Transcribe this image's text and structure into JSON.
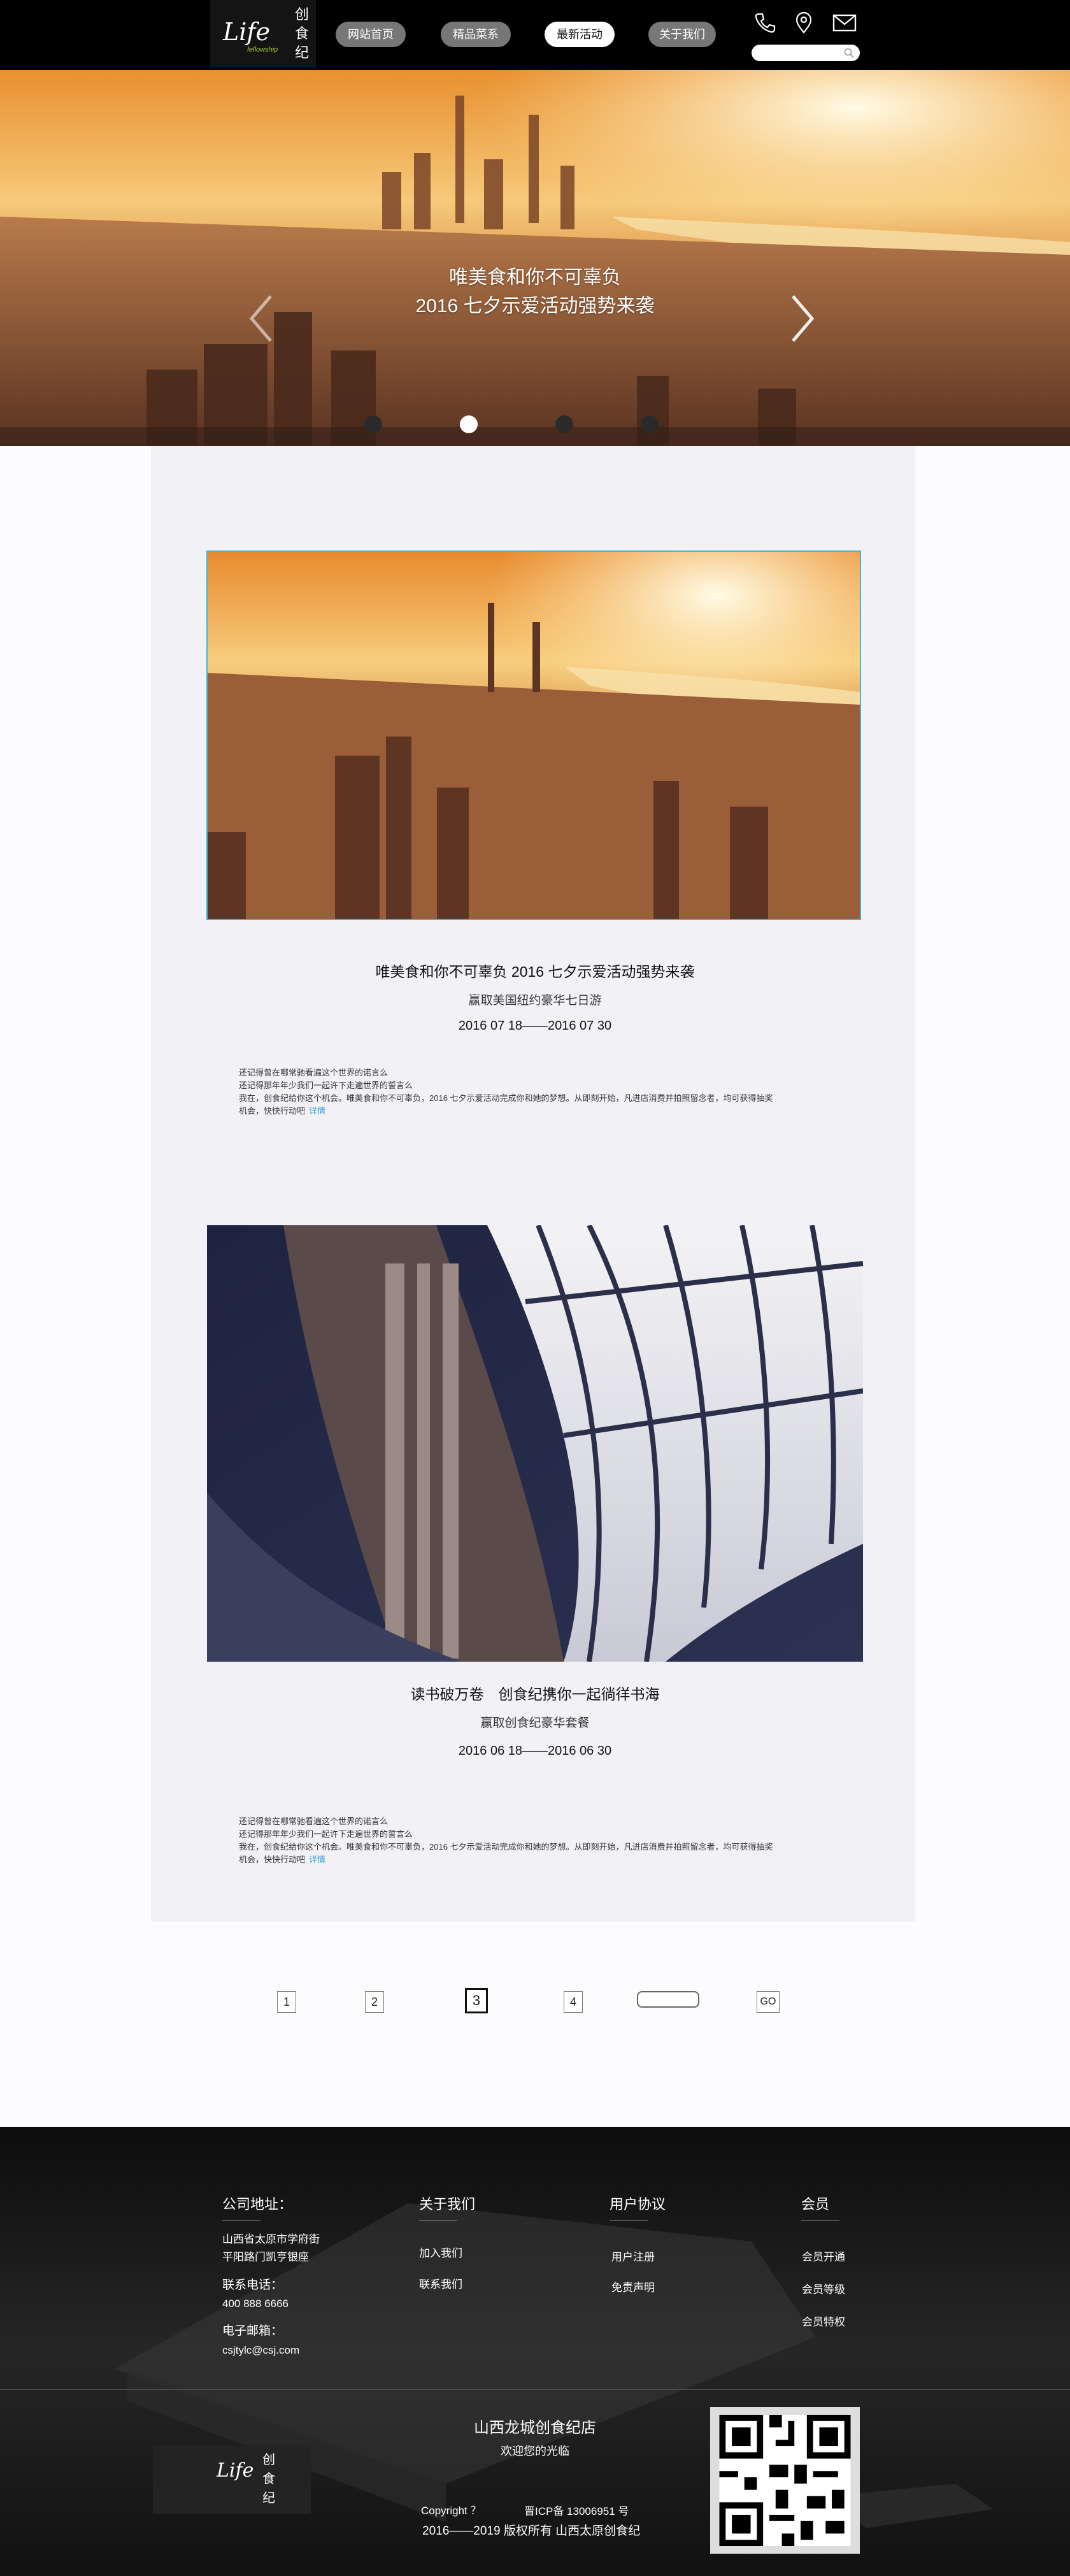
{
  "header": {
    "logo_script": "Life",
    "logo_sub": "fellowship",
    "logo_cn": [
      "创",
      "食",
      "纪"
    ],
    "nav": [
      {
        "label": "网站首页",
        "active": false
      },
      {
        "label": "精品菜系",
        "active": false
      },
      {
        "label": "最新活动",
        "active": true
      },
      {
        "label": "关于我们",
        "active": false
      }
    ],
    "icons": [
      "phone-icon",
      "location-icon",
      "mail-icon",
      "search-icon"
    ],
    "search": {
      "placeholder": ""
    }
  },
  "hero": {
    "line1": "唯美食和你不可辜负",
    "line2": "2016 七夕示爱活动强势来袭",
    "slide_count": 4,
    "active_slide": 1
  },
  "articles": [
    {
      "title": "唯美食和你不可辜负 2016 七夕示爱活动强势来袭",
      "subtitle": "赢取美国纽约豪华七日游",
      "date": "2016 07 18——2016 07 30",
      "body": [
        "还记得曾在哪常驰看遍这个世界的诺言么",
        "还记得那年年少我们一起许下走遍世界的誓言么",
        "我在，创食纪给你这个机会。唯美食和你不可辜负，2016 七夕示爱活动完成你和她的梦想。从即刻开始，凡进店消费并拍照留念者，均可获得抽奖",
        "机会，快快行动吧"
      ],
      "more": "详情"
    },
    {
      "title": "读书破万卷　创食纪携你一起徜徉书海",
      "subtitle": "赢取创食纪豪华套餐",
      "date": "2016 06 18——2016 06 30",
      "body": [
        "还记得曾在哪常驰看遍这个世界的诺言么",
        "还记得那年年少我们一起许下走遍世界的誓言么",
        "我在，创食纪给你这个机会。唯美食和你不可辜负，2016 七夕示爱活动完成你和她的梦想。从即刻开始，凡进店消费并拍照留念者，均可获得抽奖",
        "机会，快快行动吧"
      ],
      "more": "详情"
    }
  ],
  "pagination": {
    "pages": [
      "1",
      "2",
      "3",
      "4"
    ],
    "active": "3",
    "go_label": "GO"
  },
  "footer": {
    "address_title": "公司地址：",
    "address_lines": [
      "山西省太原市学府街",
      "平阳路门凯亨银座"
    ],
    "phone_title": "联系电话：",
    "phone": "400  888  6666",
    "email_title": "电子邮箱：",
    "email": "csjtylc@csj.com",
    "about_title": "关于我们",
    "about_links": [
      "加入我们",
      "联系我们"
    ],
    "agreement_title": "用户协议",
    "agreement_links": [
      "用户注册",
      "免责声明"
    ],
    "member_title": "会员",
    "member_links": [
      "会员开通",
      "会员等级",
      "会员特权"
    ],
    "store_name": "山西龙城创食纪店",
    "welcome": "欢迎您的光临",
    "copyright": "Copyright ？",
    "icp": "晋ICP备 13006951 号",
    "rights": "2016——2019 版权所有  山西太原创食纪"
  }
}
